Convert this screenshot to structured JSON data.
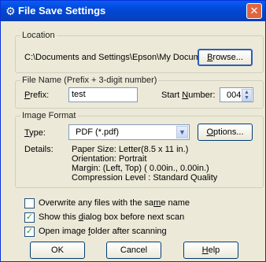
{
  "window": {
    "title": "File Save Settings",
    "close_label": "✕"
  },
  "location": {
    "legend": "Location",
    "path": "C:\\Documents and Settings\\Epson\\My Document",
    "browse_button": {
      "label": "Browse...",
      "underline": "B",
      "rest": "rowse..."
    }
  },
  "file_name": {
    "legend": "File Name (Prefix + 3-digit number)",
    "prefix_label": {
      "underline": "P",
      "rest": "refix:"
    },
    "prefix_value": "test",
    "start_number_label": {
      "pre": "Start ",
      "underline": "N",
      "rest": "umber:"
    },
    "start_number_value": "004"
  },
  "image_format": {
    "legend": "Image Format",
    "type_label": {
      "underline": "T",
      "rest": "ype:"
    },
    "type_value": "PDF (*.pdf)",
    "options_button": {
      "label": "Options...",
      "underline": "O",
      "rest": "ptions..."
    },
    "details_label": "Details:",
    "details": [
      "Paper Size: Letter(8.5 x 11 in.)",
      "Orientation: Portrait",
      "Margin: (Left, Top) ( 0.00in., 0.00in.)",
      "Compression Level : Standard Quality"
    ]
  },
  "checkboxes": [
    {
      "pre": "Overwrite any files with the sa",
      "underline": "m",
      "rest": "e name",
      "checked": false
    },
    {
      "pre": "Show this ",
      "underline": "d",
      "rest": "ialog box before next scan",
      "checked": true
    },
    {
      "pre": "Open image ",
      "underline": "f",
      "rest": "older after scanning",
      "checked": true
    }
  ],
  "buttons": {
    "ok": "OK",
    "cancel": "Cancel",
    "help": {
      "underline": "H",
      "rest": "elp"
    }
  },
  "icons": {
    "title": "gear-icon",
    "close": "close-icon",
    "spin": "spin-arrows-icon",
    "dropdown": "chevron-down-icon",
    "check": "checkmark-icon"
  }
}
